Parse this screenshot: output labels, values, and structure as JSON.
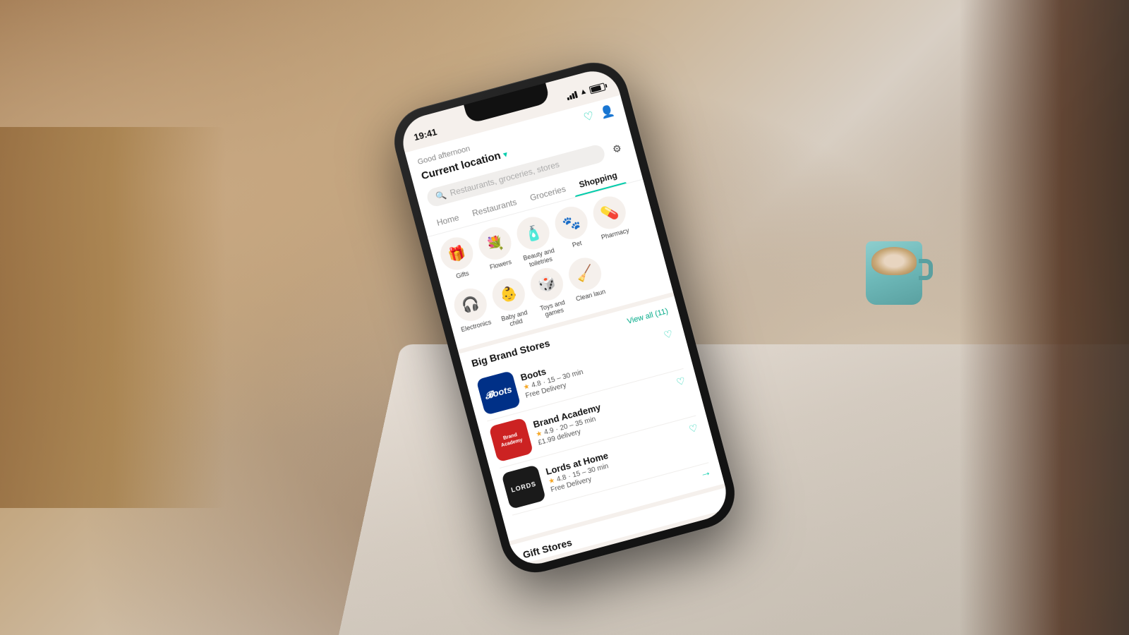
{
  "background": {
    "color": "#8b6a4a"
  },
  "status_bar": {
    "time": "19:41"
  },
  "header": {
    "greeting": "Good afternoon",
    "location": "Current location",
    "search_placeholder": "Restaurants, groceries, stores"
  },
  "nav": {
    "tabs": [
      {
        "label": "Home",
        "active": false
      },
      {
        "label": "Restaurants",
        "active": false
      },
      {
        "label": "Groceries",
        "active": false
      },
      {
        "label": "Shopping",
        "active": true
      }
    ]
  },
  "categories": [
    {
      "icon": "🎁",
      "label": "Gifts"
    },
    {
      "icon": "💐",
      "label": "Flowers"
    },
    {
      "icon": "🧴",
      "label": "Beauty and toiletries"
    },
    {
      "icon": "🐾",
      "label": "Pet"
    },
    {
      "icon": "💊",
      "label": "Pharmacy"
    },
    {
      "icon": "🎧",
      "label": "Electronics"
    },
    {
      "icon": "👶",
      "label": "Baby and child"
    },
    {
      "icon": "🎲",
      "label": "Toys and games"
    },
    {
      "icon": "🧹",
      "label": "Clean laun"
    }
  ],
  "big_brand_stores": {
    "title": "Big Brand Stores",
    "view_all": "View all (11)",
    "stores": [
      {
        "name": "Boots",
        "logo_text": "Boots",
        "logo_style": "boots",
        "rating": "4.8",
        "time": "15 – 30 min",
        "delivery": "Free Delivery"
      },
      {
        "name": "Brand Academy",
        "logo_text": "Brand Academy",
        "logo_style": "brand",
        "rating": "4.9",
        "time": "20 – 35 min",
        "delivery": "£1.99 delivery"
      },
      {
        "name": "Lords at Home",
        "logo_text": "LORDS",
        "logo_style": "lords",
        "rating": "4.8",
        "time": "15 – 30 min",
        "delivery": "Free Delivery"
      }
    ]
  },
  "gift_stores": {
    "title": "Gift Stores"
  },
  "icons": {
    "heart": "♡",
    "profile": "👤",
    "search": "🔍",
    "filter": "≡",
    "star": "★",
    "chevron_down": "▾",
    "arrow_right": "→"
  }
}
